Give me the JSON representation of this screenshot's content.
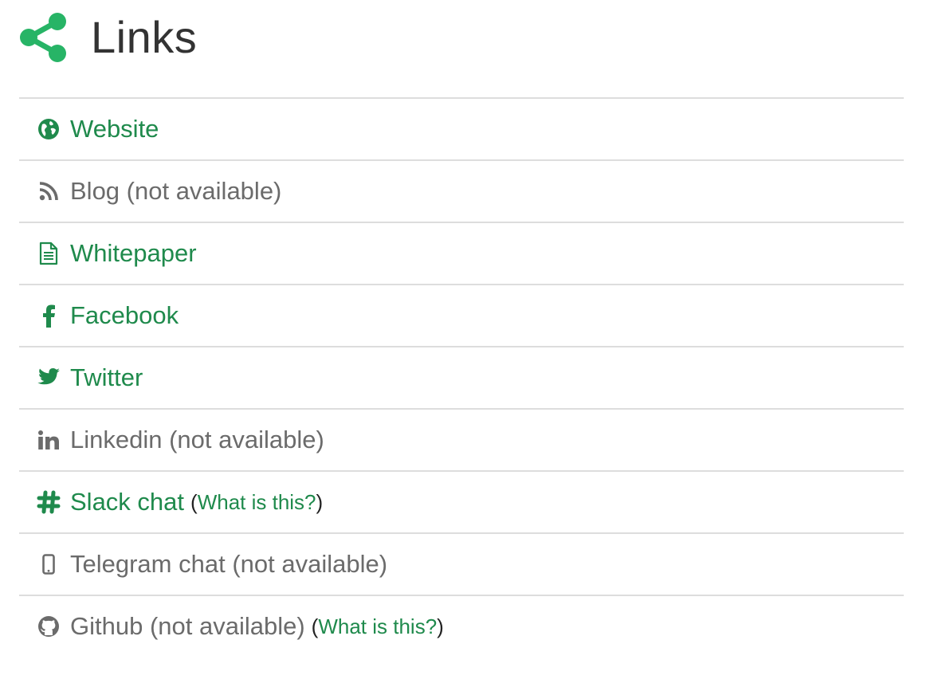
{
  "header": {
    "title": "Links",
    "icon": "share-icon",
    "accent_color": "#27b466"
  },
  "colors": {
    "link_green": "#1f8a4c",
    "muted_gray": "#6b6b6b",
    "divider": "#dddddd"
  },
  "links": [
    {
      "label": "Website",
      "icon": "globe-icon",
      "status": "active"
    },
    {
      "label": "Blog (not available)",
      "icon": "rss-icon",
      "status": "unavailable"
    },
    {
      "label": "Whitepaper",
      "icon": "document-icon",
      "status": "active"
    },
    {
      "label": "Facebook",
      "icon": "facebook-icon",
      "status": "active"
    },
    {
      "label": "Twitter",
      "icon": "twitter-icon",
      "status": "active"
    },
    {
      "label": "Linkedin (not available)",
      "icon": "linkedin-icon",
      "status": "unavailable"
    },
    {
      "label": "Slack chat",
      "icon": "hashtag-icon",
      "status": "active",
      "help_open": "(",
      "help_link": "What is this?",
      "help_close": ")"
    },
    {
      "label": "Telegram chat (not available)",
      "icon": "mobile-icon",
      "status": "unavailable"
    },
    {
      "label": "Github (not available)",
      "icon": "github-icon",
      "status": "unavailable",
      "help_open": "(",
      "help_link": "What is this?",
      "help_close": ")"
    }
  ]
}
